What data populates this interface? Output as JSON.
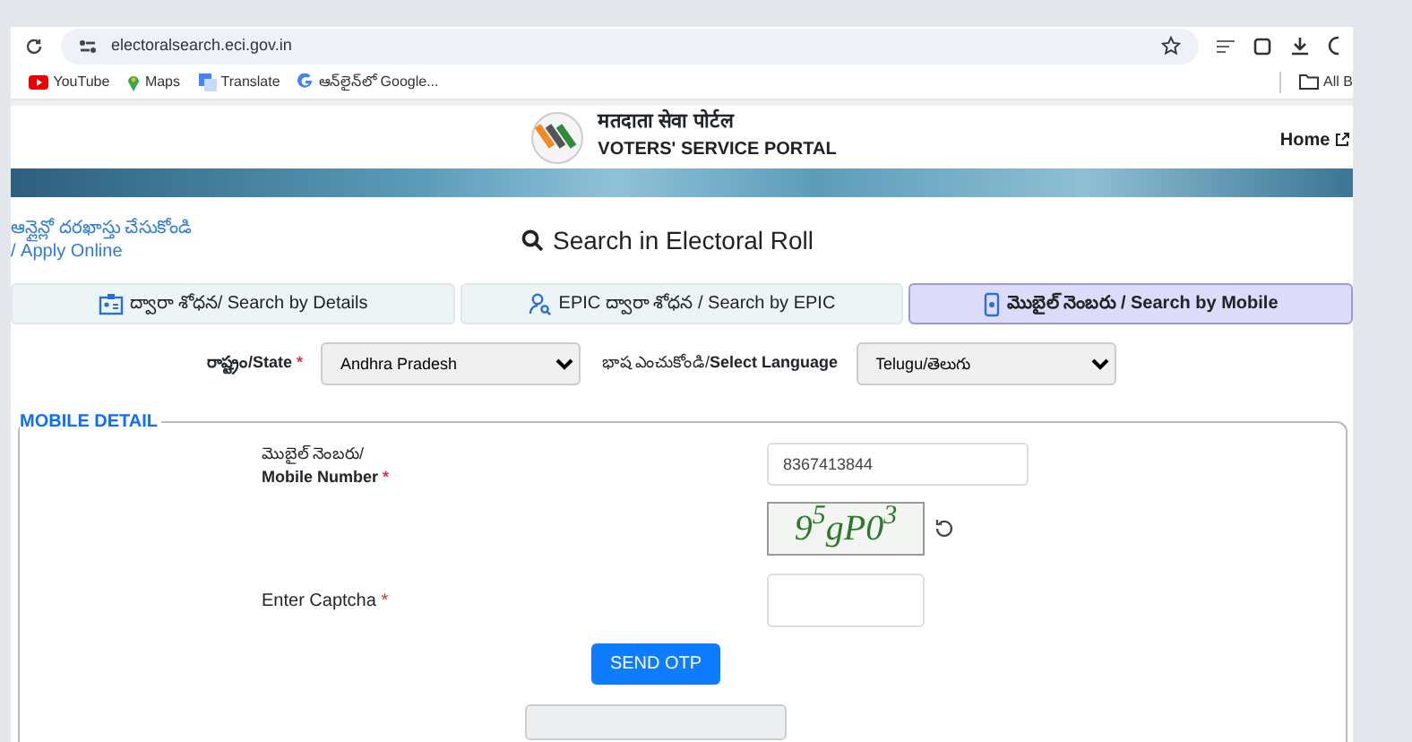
{
  "browser": {
    "url": "electoralsearch.eci.gov.in",
    "bookmarks": [
      {
        "kind": "youtube",
        "label": "YouTube"
      },
      {
        "kind": "maps",
        "label": "Maps"
      },
      {
        "kind": "translate",
        "label": "Translate"
      },
      {
        "kind": "google",
        "label": "ఆన్‌లైన్‌లో Google..."
      }
    ],
    "all_bookmarks": "All B"
  },
  "header": {
    "title_hindi": "मतदाता सेवा पोर्टल",
    "title": "VOTERS' SERVICE PORTAL",
    "home": "Home"
  },
  "apply_link": {
    "line1": "ఆన్లైన్లో దరఖాస్తు చేసుకోండి",
    "line2": "/ Apply Online"
  },
  "page_title": "Search in Electoral Roll",
  "tabs": [
    {
      "kind": "details",
      "label": "ద్వారా శోధన/ Search by Details",
      "selected": false
    },
    {
      "kind": "epic",
      "label": "EPIC ద్వారా శోధన / Search by EPIC",
      "selected": false
    },
    {
      "kind": "mobile",
      "label": "మొబైల్ నెంబరు / Search by Mobile",
      "selected": true
    }
  ],
  "state": {
    "label": "రాష్ట్రం/State",
    "required_mark": "*",
    "value": "Andhra Pradesh"
  },
  "language": {
    "label_telugu": "భాష ఎంచుకోండి/",
    "label": "Select Language",
    "value": "Telugu/తెలుగు"
  },
  "mobile_detail": {
    "legend": "MOBILE DETAIL",
    "mobile": {
      "label_telugu": "మొబైల్ నెంబరు/",
      "label": "Mobile Number",
      "required_mark": "*",
      "value": "8367413844"
    },
    "captcha_image": "9$^{5}$gP0$^{3}$",
    "captcha": {
      "label": "Enter Captcha",
      "required_mark": "*"
    },
    "send_button": "SEND OTP"
  }
}
